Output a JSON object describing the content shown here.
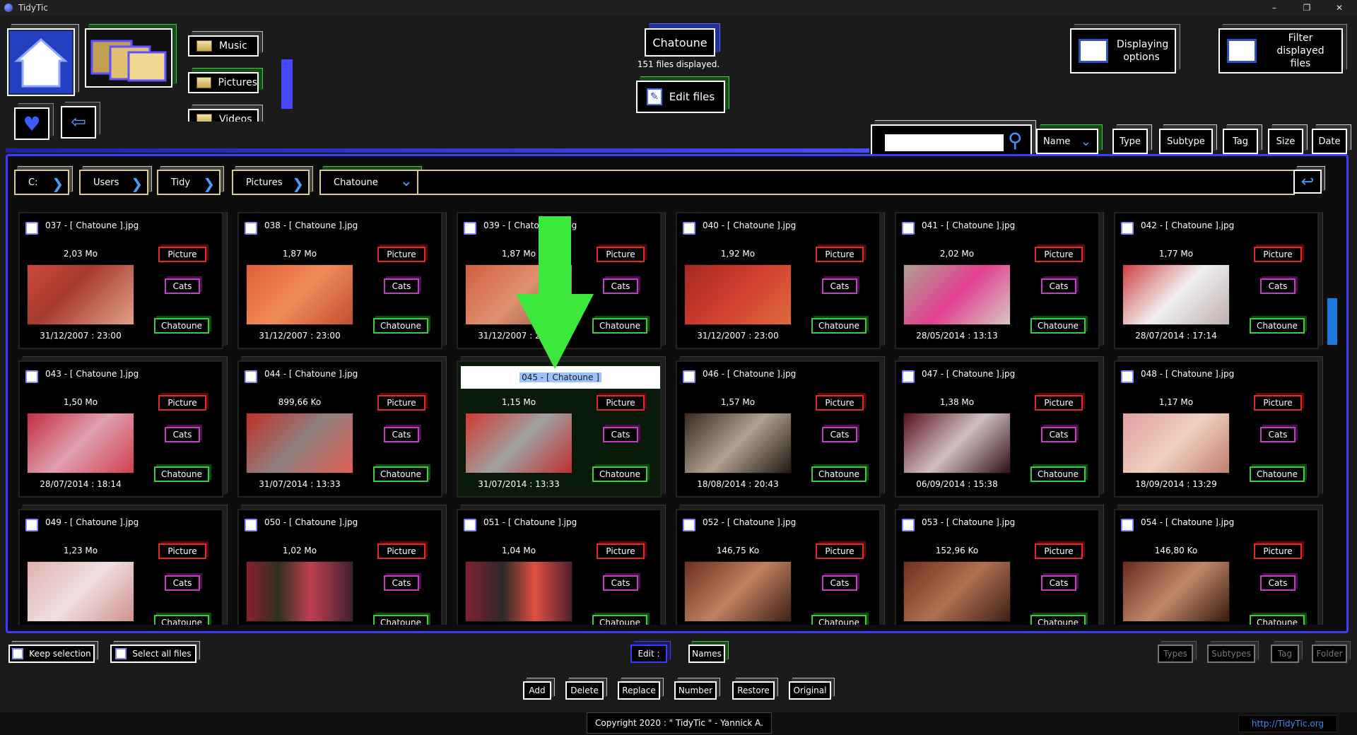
{
  "window": {
    "title": "TidyTic",
    "minimize": "–",
    "maximize": "❐",
    "close": "✕"
  },
  "nav": {
    "music": "Music",
    "pictures": "Pictures",
    "videos": "Videos"
  },
  "header": {
    "folder_name": "Chatoune",
    "files_displayed": "151 files displayed.",
    "edit_files": "Edit files",
    "displaying_options": "Displaying options",
    "filter_files": "Filter displayed files"
  },
  "sort": {
    "name": "Name",
    "type": "Type",
    "subtype": "Subtype",
    "tag": "Tag",
    "size": "Size",
    "date": "Date"
  },
  "search": {
    "placeholder": ""
  },
  "breadcrumb": [
    "C:",
    "Users",
    "Tidy",
    "Pictures",
    "Chatoune"
  ],
  "files": [
    {
      "name": "037 - [ Chatoune ].jpg",
      "size": "2,03 Mo",
      "date": "31/12/2007 : 23:00",
      "type": "Picture",
      "subtype": "Cats",
      "tag": "Chatoune",
      "thumb": "linear-gradient(135deg,#c84a3a,#a83a30 40%,#e0a088)"
    },
    {
      "name": "038 - [ Chatoune ].jpg",
      "size": "1,87 Mo",
      "date": "31/12/2007 : 23:00",
      "type": "Picture",
      "subtype": "Cats",
      "tag": "Chatoune",
      "thumb": "linear-gradient(135deg,#e0603a,#f08a5a 50%,#c05030)"
    },
    {
      "name": "039 - [ Chatoune ].jpg",
      "size": "1,87 Mo",
      "date": "31/12/2007 : 23:00",
      "type": "Picture",
      "subtype": "Cats",
      "tag": "Chatoune",
      "thumb": "linear-gradient(135deg,#d06040,#e09070 50%,#8a5a40)"
    },
    {
      "name": "040 - [ Chatoune ].jpg",
      "size": "1,92 Mo",
      "date": "31/12/2007 : 23:00",
      "type": "Picture",
      "subtype": "Cats",
      "tag": "Chatoune",
      "thumb": "linear-gradient(135deg,#a82820,#d04030 50%,#e06a3a)"
    },
    {
      "name": "041 - [ Chatoune ].jpg",
      "size": "2,02 Mo",
      "date": "28/05/2014 : 13:13",
      "type": "Picture",
      "subtype": "Cats",
      "tag": "Chatoune",
      "thumb": "linear-gradient(135deg,#b0a090,#e04090 50%,#d8c8c0)"
    },
    {
      "name": "042 - [ Chatoune ].jpg",
      "size": "1,77 Mo",
      "date": "28/07/2014 : 17:14",
      "type": "Picture",
      "subtype": "Cats",
      "tag": "Chatoune",
      "thumb": "linear-gradient(135deg,#d04040,#f0f0f0 50%,#c0b0b0)"
    },
    {
      "name": "043 - [ Chatoune ].jpg",
      "size": "1,50 Mo",
      "date": "28/07/2014 : 18:14",
      "type": "Picture",
      "subtype": "Cats",
      "tag": "Chatoune",
      "thumb": "linear-gradient(135deg,#c03040,#e0a0b0 50%,#d04050)"
    },
    {
      "name": "044 - [ Chatoune ].jpg",
      "size": "899,66 Ko",
      "date": "31/07/2014 : 13:33",
      "type": "Picture",
      "subtype": "Cats",
      "tag": "Chatoune",
      "thumb": "linear-gradient(135deg,#c03028,#908080 50%,#e06050)"
    },
    {
      "name": "045 - [ Chatoune ]",
      "size": "1,15 Mo",
      "date": "31/07/2014 : 13:33",
      "type": "Picture",
      "subtype": "Cats",
      "tag": "Chatoune",
      "thumb": "linear-gradient(135deg,#d03a30,#a0a0a0 50%,#c03030)"
    },
    {
      "name": "046 - [ Chatoune ].jpg",
      "size": "1,57 Mo",
      "date": "18/08/2014 : 20:43",
      "type": "Picture",
      "subtype": "Cats",
      "tag": "Chatoune",
      "thumb": "linear-gradient(135deg,#3a2a20,#b0a090 50%,#201810)"
    },
    {
      "name": "047 - [ Chatoune ].jpg",
      "size": "1,38 Mo",
      "date": "06/09/2014 : 15:38",
      "type": "Picture",
      "subtype": "Cats",
      "tag": "Chatoune",
      "thumb": "linear-gradient(135deg,#5a1020,#d0c0c0 50%,#301018)"
    },
    {
      "name": "048 - [ Chatoune ].jpg",
      "size": "1,17 Mo",
      "date": "18/09/2014 : 13:29",
      "type": "Picture",
      "subtype": "Cats",
      "tag": "Chatoune",
      "thumb": "linear-gradient(135deg,#e0a0a0,#f0d0c0 50%,#c08070)"
    },
    {
      "name": "049 - [ Chatoune ].jpg",
      "size": "1,23 Mo",
      "date": "",
      "type": "Picture",
      "subtype": "Cats",
      "tag": "Chatoune",
      "thumb": "linear-gradient(135deg,#e0b0b0,#f0e0e0 50%,#d09090)"
    },
    {
      "name": "050 - [ Chatoune ].jpg",
      "size": "1,02 Mo",
      "date": "",
      "type": "Picture",
      "subtype": "Cats",
      "tag": "Chatoune",
      "thumb": "linear-gradient(90deg,#8a2030,#303020 30%,#c04050 60%,#402030)"
    },
    {
      "name": "051 - [ Chatoune ].jpg",
      "size": "1,04 Mo",
      "date": "",
      "type": "Picture",
      "subtype": "Cats",
      "tag": "Chatoune",
      "thumb": "linear-gradient(90deg,#802030,#302828 35%,#e05040 65%,#502030)"
    },
    {
      "name": "052 - [ Chatoune ].jpg",
      "size": "146,75 Ko",
      "date": "",
      "type": "Picture",
      "subtype": "Cats",
      "tag": "Chatoune",
      "thumb": "linear-gradient(135deg,#6a3020,#c08060 50%,#402018)"
    },
    {
      "name": "053 - [ Chatoune ].jpg",
      "size": "152,96 Ko",
      "date": "",
      "type": "Picture",
      "subtype": "Cats",
      "tag": "Chatoune",
      "thumb": "linear-gradient(135deg,#703020,#b07050 50%,#402018)"
    },
    {
      "name": "054 - [ Chatoune ].jpg",
      "size": "146,80 Ko",
      "date": "",
      "type": "Picture",
      "subtype": "Cats",
      "tag": "Chatoune",
      "thumb": "linear-gradient(135deg,#6a2a20,#c08868 50%,#3a1a10)"
    }
  ],
  "selected_index": 8,
  "footer": {
    "keep_selection": "Keep selection",
    "select_all": "Select all files",
    "edit_label": "Edit :",
    "names": "Names",
    "types": "Types",
    "subtypes": "Subtypes",
    "tag": "Tag",
    "folder": "Folder",
    "add": "Add",
    "delete": "Delete",
    "replace": "Replace",
    "number": "Number",
    "restore": "Restore",
    "original": "Original",
    "copyright": "Copyright 2020 : \" TidyTic \" - Yannick A.",
    "url": "http://TidyTic.org"
  },
  "colors": {
    "accent_blue": "#3c3cff",
    "green": "#3ccd3c",
    "red": "#e02a2a",
    "purple": "#c040c0",
    "link": "#3a8cff",
    "arrow": "#3ce83c"
  }
}
